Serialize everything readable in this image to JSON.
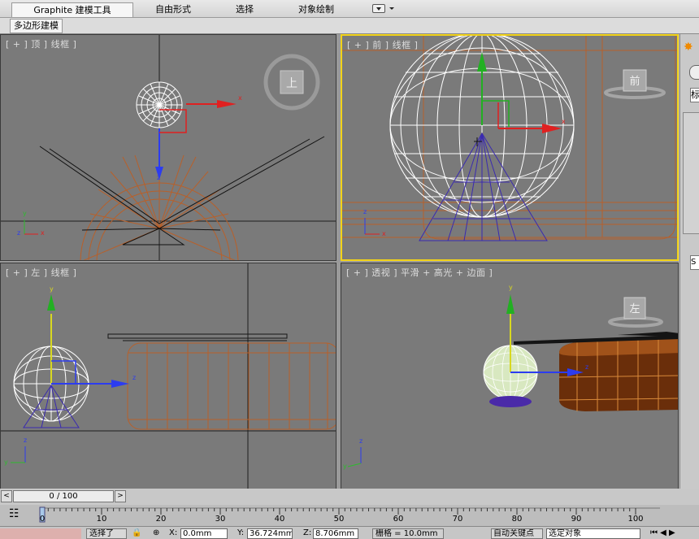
{
  "ribbon": {
    "tabs": [
      "Graphite 建模工具",
      "自由形式",
      "选择",
      "对象绘制"
    ],
    "subtab": "多边形建模"
  },
  "viewports": {
    "top": {
      "label": "[ + ] 顶 ] 线框 ]",
      "cube": "上",
      "axes": {
        "x": "x",
        "y": "y",
        "z": "z"
      }
    },
    "front": {
      "label": "[ + ] 前 ] 线框 ]",
      "cube": "前",
      "axes": {
        "x": "x",
        "z": "z"
      }
    },
    "left": {
      "label": "[ + ] 左 ] 线框 ]",
      "axes": {
        "y": "y",
        "z": "z"
      }
    },
    "persp": {
      "label": "[ + ] 透视 ] 平滑 + 高光 + 边面 ]",
      "cube": "左",
      "axes": {
        "y": "y",
        "z": "z"
      }
    }
  },
  "timeline": {
    "slider": "0 / 100",
    "prev": "<",
    "next": ">",
    "ticks": [
      "0",
      "10",
      "20",
      "30",
      "40",
      "50",
      "60",
      "70",
      "80",
      "90",
      "100"
    ]
  },
  "status": {
    "selected": "选择了",
    "x_label": "X:",
    "x_value": "0.0mm",
    "y_label": "Y:",
    "y_value": "36.724mm",
    "z_label": "Z:",
    "z_value": "8.706mm",
    "grid": "栅格 = 10.0mm",
    "autokey": "自动关键点",
    "selection_set": "选定对象"
  },
  "right_panel": {
    "std": "标",
    "item_s": "S"
  }
}
